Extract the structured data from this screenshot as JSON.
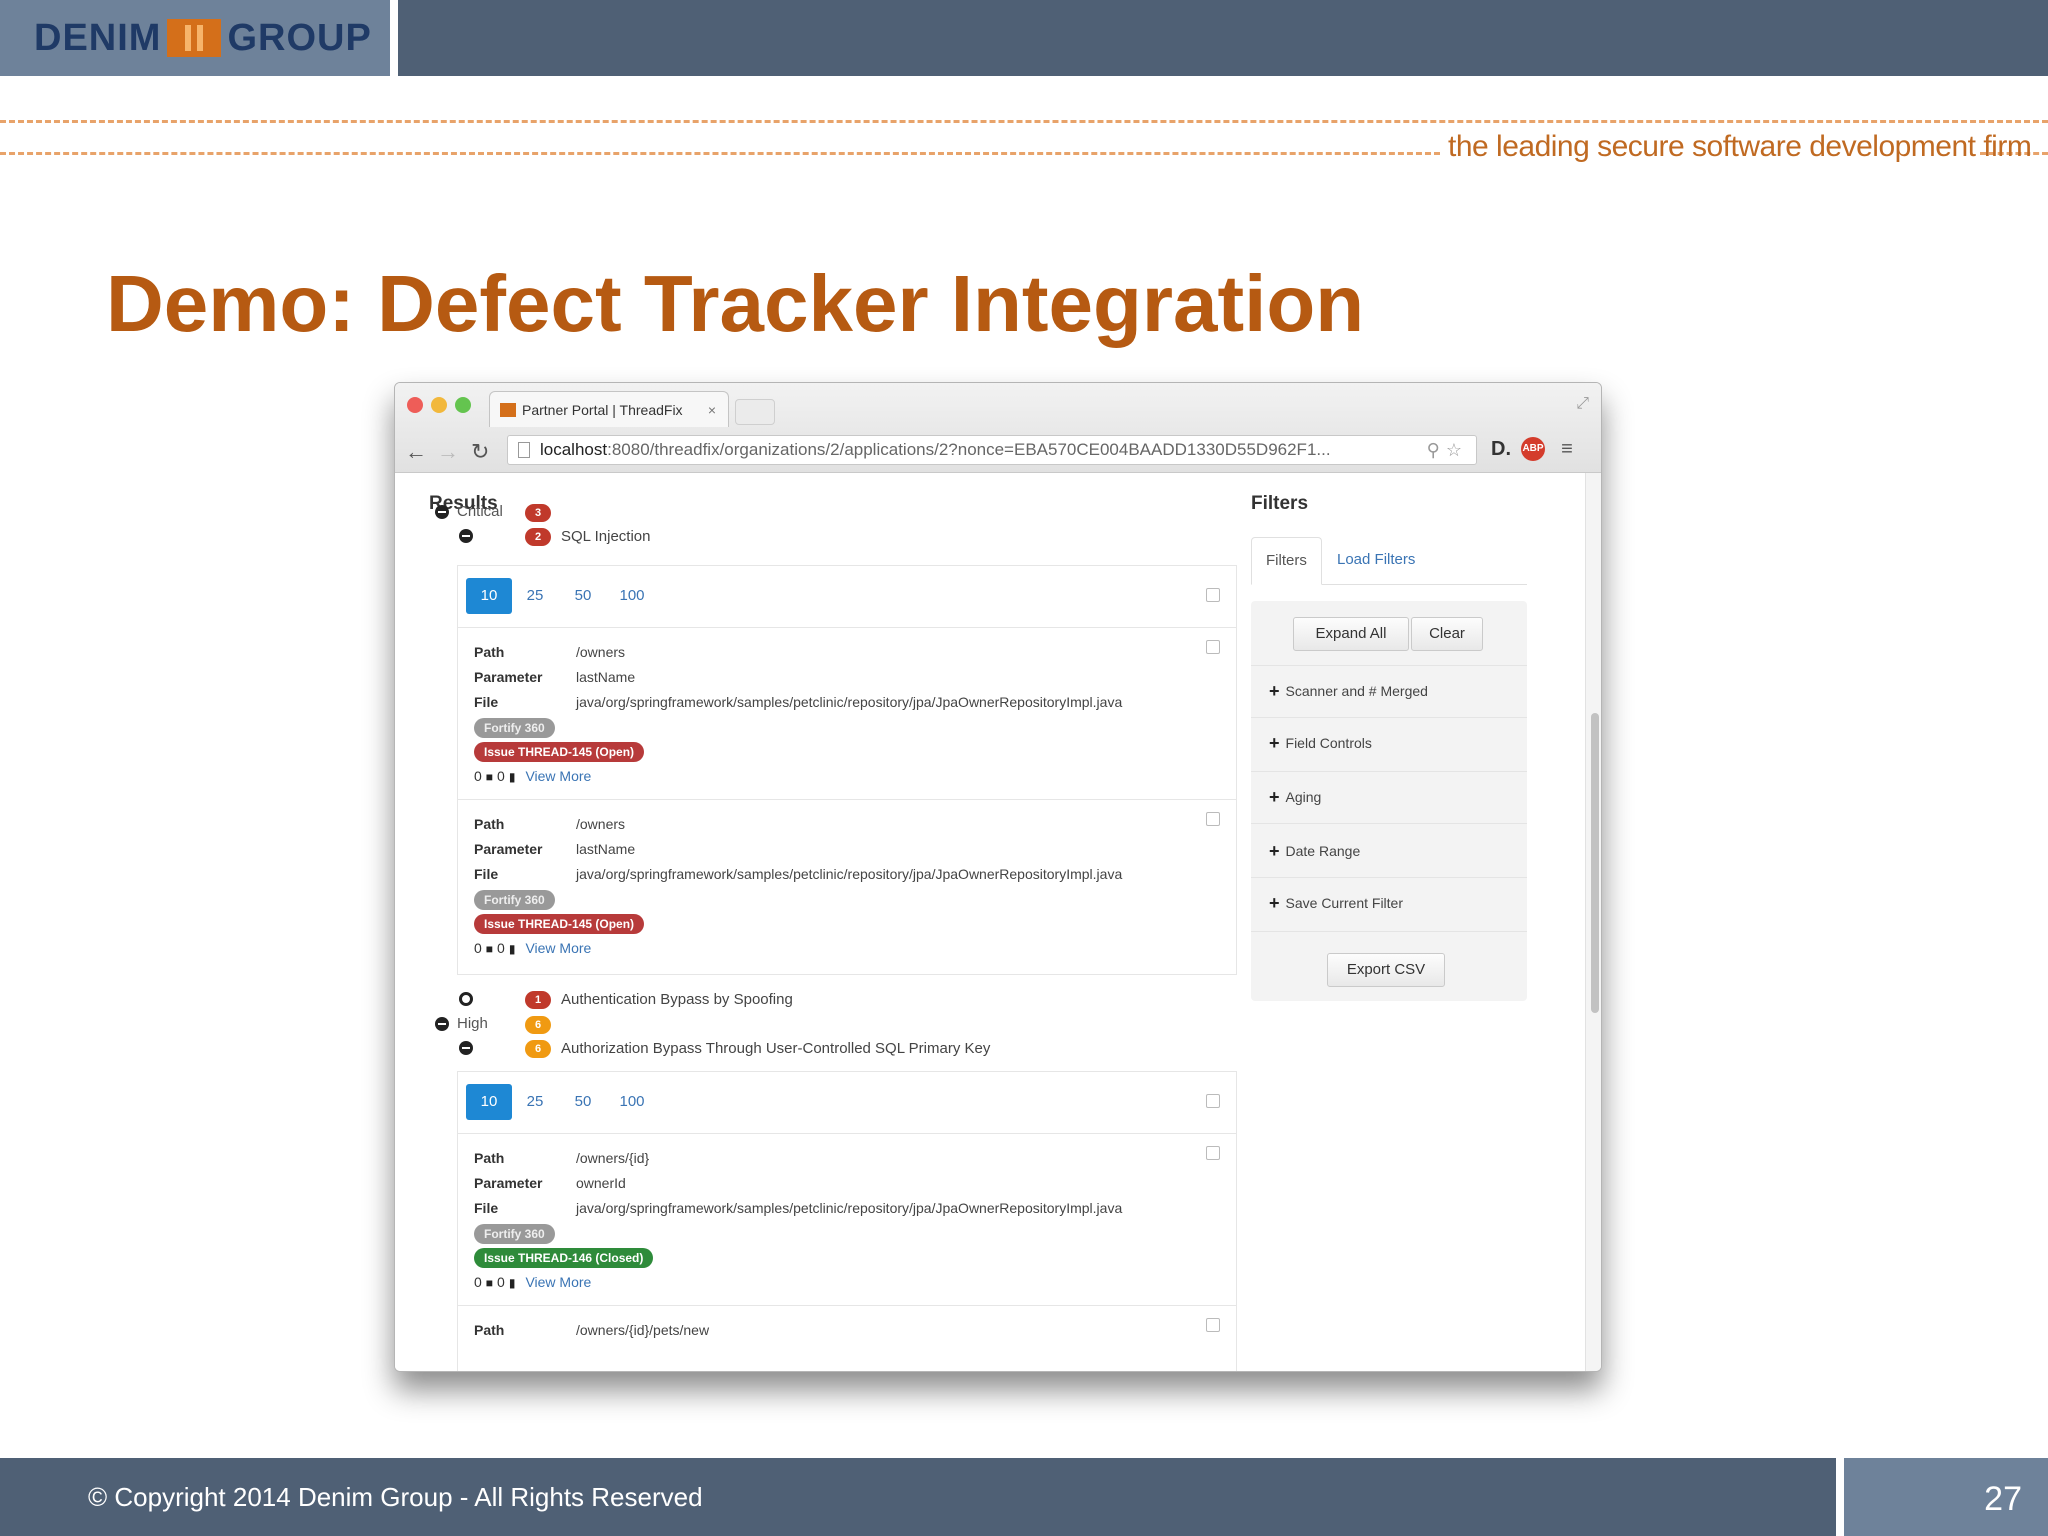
{
  "slide": {
    "logo_left": "DENIM",
    "logo_right": "GROUP",
    "tagline": "the leading secure software development firm",
    "title": "Demo: Defect Tracker Integration",
    "footer": "© Copyright 2014  Denim Group - All Rights Reserved",
    "page_number": "27"
  },
  "browser": {
    "tab_title": "Partner Portal | ThreadFix",
    "tab_close": "×",
    "url_host": "localhost",
    "url_rest": ":8080/threadfix/organizations/2/applications/2?nonce=EBA570CE004BAADD1330D55D962F1...",
    "back_icon": "arrow-left",
    "forward_icon": "arrow-right",
    "reload_icon": "reload",
    "menu_icon": "hamburger-menu"
  },
  "results": {
    "heading": "Results",
    "groups": [
      {
        "severity": "Critical",
        "count": "3",
        "vulns": [
          {
            "count": "2",
            "name": "SQL Injection"
          },
          {
            "count": "1",
            "name": "Authentication Bypass by Spoofing"
          }
        ]
      },
      {
        "severity": "High",
        "count": "6",
        "vulns": [
          {
            "count": "6",
            "name": "Authorization Bypass Through User-Controlled SQL Primary Key"
          }
        ]
      }
    ],
    "pager": [
      "10",
      "25",
      "50",
      "100"
    ],
    "labels": {
      "path": "Path",
      "parameter": "Parameter",
      "file": "File",
      "view_more": "View More"
    },
    "findings": [
      {
        "path": "/owners",
        "parameter": "lastName",
        "file": "java/org/springframework/samples/petclinic/repository/jpa/JpaOwnerRepositoryImpl.java",
        "scanner": "Fortify 360",
        "issue": "Issue THREAD-145 (Open)",
        "comments": "0",
        "files": "0"
      },
      {
        "path": "/owners",
        "parameter": "lastName",
        "file": "java/org/springframework/samples/petclinic/repository/jpa/JpaOwnerRepositoryImpl.java",
        "scanner": "Fortify 360",
        "issue": "Issue THREAD-145 (Open)",
        "comments": "0",
        "files": "0"
      },
      {
        "path": "/owners/{id}",
        "parameter": "ownerId",
        "file": "java/org/springframework/samples/petclinic/repository/jpa/JpaOwnerRepositoryImpl.java",
        "scanner": "Fortify 360",
        "issue": "Issue THREAD-146 (Closed)",
        "comments": "0",
        "files": "0"
      },
      {
        "path": "/owners/{id}/pets/new"
      }
    ]
  },
  "filters": {
    "heading": "Filters",
    "tabs": [
      "Filters",
      "Load Filters"
    ],
    "expand_all": "Expand All",
    "clear": "Clear",
    "items": [
      "Scanner and # Merged",
      "Field Controls",
      "Aging",
      "Date Range",
      "Save Current Filter"
    ],
    "export_csv": "Export CSV"
  },
  "colors": {
    "title": "#b65a12",
    "bar": "#4f6075",
    "critical": "#c0392b",
    "high": "#f09a12",
    "issue_open": "#b73a3a",
    "issue_closed": "#2e8b3a",
    "pager_active": "#1e88d4"
  }
}
